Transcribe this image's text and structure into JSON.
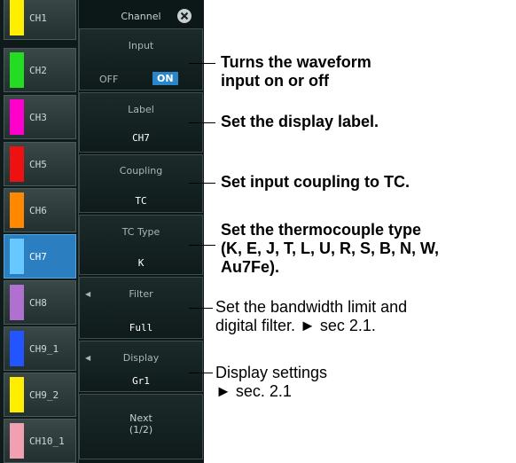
{
  "channels": [
    {
      "label": "CH1",
      "color": "#ffee00"
    },
    {
      "label": "CH2",
      "color": "#22dd22"
    },
    {
      "label": "CH3",
      "color": "#ff00cc"
    },
    {
      "label": "CH5",
      "color": "#ee1111"
    },
    {
      "label": "CH6",
      "color": "#ff8800"
    },
    {
      "label": "CH7",
      "color": "#66c8ff"
    },
    {
      "label": "CH8",
      "color": "#b070d0"
    },
    {
      "label": "CH9_1",
      "color": "#2255ff"
    },
    {
      "label": "CH9_2",
      "color": "#ffee00"
    },
    {
      "label": "CH10_1",
      "color": "#f0a0b0"
    }
  ],
  "selected_channel": "CH7",
  "menu": {
    "title": "Channel",
    "input": {
      "label": "Input",
      "off": "OFF",
      "on": "ON"
    },
    "label": {
      "label": "Label",
      "value": "CH7"
    },
    "coupling": {
      "label": "Coupling",
      "value": "TC"
    },
    "tc_type": {
      "label": "TC Type",
      "value": "K"
    },
    "filter": {
      "label": "Filter",
      "value": "Full"
    },
    "display": {
      "label": "Display",
      "value": "Gr1"
    },
    "next": {
      "line1": "Next",
      "line2": "(1/2)"
    }
  },
  "annotations": {
    "input_1": "Turns the waveform",
    "input_2": "input on or off",
    "label": "Set the display label.",
    "coupling": "Set input coupling to TC.",
    "tc_1": "Set the thermocouple type",
    "tc_2": "(K, E, J, T, L, U, R, S, B, N, W,",
    "tc_3": "Au7Fe).",
    "filter_1": "Set the bandwidth limit and",
    "filter_2": "digital filter. ► sec 2.1.",
    "display_1": "Display settings",
    "display_2": "► sec. 2.1"
  }
}
